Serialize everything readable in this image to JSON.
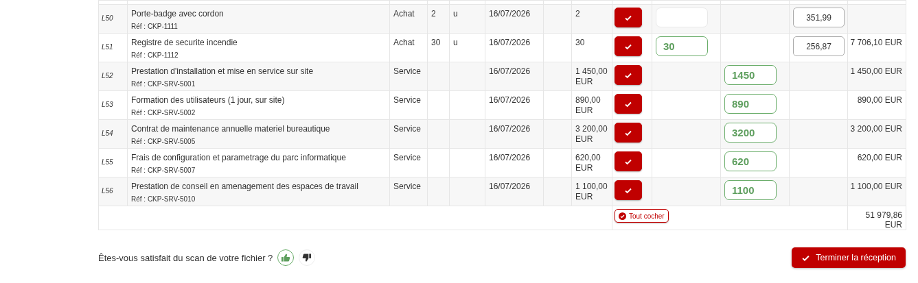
{
  "table": {
    "rows": [
      {
        "line": "L50",
        "designation": "Porte-badge avec cordon",
        "reference": "Réf : CKP-1111",
        "type": "Achat",
        "quantity": "2",
        "unit": "u",
        "date": "16/07/2026",
        "ordered": "2",
        "checked": true,
        "received": {
          "filled": false
        },
        "price": "351,99"
      },
      {
        "line": "L51",
        "designation": "Registre de securite incendie",
        "reference": "Réf : CKP-1112",
        "type": "Achat",
        "quantity": "30",
        "unit": "u",
        "date": "16/07/2026",
        "ordered": "30",
        "checked": true,
        "received": {
          "value": "30",
          "filled": true
        },
        "price": "256,87",
        "total": "7 706,10 EUR"
      },
      {
        "line": "L52",
        "designation": "Prestation d'installation et mise en service sur site",
        "reference": "Réf : CKP-SRV-5001",
        "type": "Service",
        "date": "16/07/2026",
        "ordered": "1 450,00 EUR",
        "checked": true,
        "amount": {
          "value": "1450",
          "filled": true
        },
        "total": "1 450,00 EUR"
      },
      {
        "line": "L53",
        "designation": "Formation des utilisateurs (1 jour, sur site)",
        "reference": "Réf : CKP-SRV-5002",
        "type": "Service",
        "date": "16/07/2026",
        "ordered": "890,00 EUR",
        "checked": true,
        "amount": {
          "value": "890",
          "filled": true
        },
        "total": "890,00 EUR"
      },
      {
        "line": "L54",
        "designation": "Contrat de maintenance annuelle materiel bureautique",
        "reference": "Réf : CKP-SRV-5005",
        "type": "Service",
        "date": "16/07/2026",
        "ordered": "3 200,00 EUR",
        "checked": true,
        "amount": {
          "value": "3200",
          "filled": true
        },
        "total": "3 200,00 EUR"
      },
      {
        "line": "L55",
        "designation": "Frais de configuration et parametrage du parc informatique",
        "reference": "Réf : CKP-SRV-5007",
        "type": "Service",
        "date": "16/07/2026",
        "ordered": "620,00 EUR",
        "checked": true,
        "amount": {
          "value": "620",
          "filled": true
        },
        "total": "620,00 EUR"
      },
      {
        "line": "L56",
        "designation": "Prestation de conseil en amenagement des espaces de travail",
        "reference": "Réf : CKP-SRV-5010",
        "type": "Service",
        "date": "16/07/2026",
        "ordered": "1 100,00 EUR",
        "checked": true,
        "amount": {
          "value": "1100",
          "filled": true
        },
        "total": "1 100,00 EUR"
      }
    ],
    "select_all": {
      "label": "Tout cocher"
    },
    "grand_total": "51 979,86 EUR"
  },
  "feedback": {
    "question": "Êtes-vous satisfait du scan de votre fichier ?",
    "options": [
      {
        "kind": "up",
        "selected": true
      },
      {
        "kind": "down",
        "selected": false
      }
    ]
  },
  "finish_button": {
    "label": "Terminer la réception"
  }
}
